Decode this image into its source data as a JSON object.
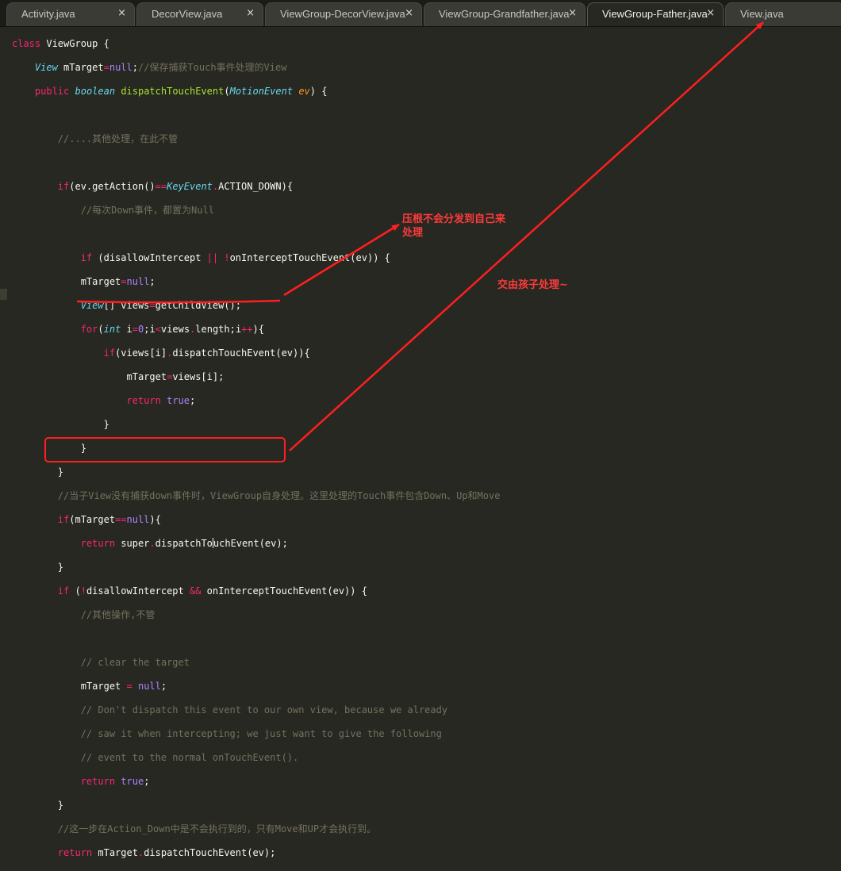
{
  "tabs": [
    {
      "label": "Activity.java",
      "active": false
    },
    {
      "label": "DecorView.java",
      "active": false
    },
    {
      "label": "ViewGroup-DecorView.java",
      "active": false
    },
    {
      "label": "ViewGroup-Grandfather.java",
      "active": false
    },
    {
      "label": "ViewGroup-Father.java",
      "active": true
    },
    {
      "label": "View.java",
      "active": false
    }
  ],
  "close_glyph": "×",
  "code": {
    "l1": {
      "a": "class",
      "b": " ViewGroup {"
    },
    "l2": {
      "a": "View",
      "b": " mTarget",
      "c": "=",
      "d": "null",
      "e": ";",
      "f": "//保存捕获Touch事件处理的View"
    },
    "l3": {
      "a": "public",
      "b": "boolean",
      "c": "dispatchTouchEvent",
      "d": "(",
      "e": "MotionEvent",
      "f": "ev",
      "g": ") {"
    },
    "l5": {
      "a": "//....其他处理，在此不管"
    },
    "l7": {
      "a": "if",
      "b": "(ev.",
      "c": "getAction",
      "d": "()",
      "e": "==",
      "f": "KeyEvent",
      "g": ".",
      "h": "ACTION_DOWN",
      "i": "){"
    },
    "l8": {
      "a": "//每次Down事件，都置为Null"
    },
    "l10": {
      "a": "if",
      "b": " (disallowIntercept ",
      "c": "||",
      "d": " ",
      "e": "!",
      "f": "onInterceptTouchEvent(ev)) {"
    },
    "l11": {
      "a": "mTarget",
      "b": "=",
      "c": "null",
      "d": ";"
    },
    "l12": {
      "a": "View",
      "b": "[] views",
      "c": "=",
      "d": "getChildView();"
    },
    "l13": {
      "a": "for",
      "b": "(",
      "c": "int",
      "d": " i",
      "e": "=",
      "f": "0",
      "g": ";i",
      "h": "<",
      "i": "views",
      "j": ".",
      "k": "length;i",
      "l": "++",
      "m": "){"
    },
    "l14": {
      "a": "if",
      "b": "(views[i]",
      "c": ".",
      "d": "dispatchTouchEvent(ev)){"
    },
    "l15": {
      "a": "mTarget",
      "b": "=",
      "c": "views[i];"
    },
    "l16": {
      "a": "return",
      "b": " ",
      "c": "true",
      "d": ";"
    },
    "l17": {
      "a": "}"
    },
    "l18": {
      "a": "}"
    },
    "l19": {
      "a": "}"
    },
    "l20": {
      "a": "//当子View没有捕获down事件时，ViewGroup自身处理。这里处理的Touch事件包含Down、Up和Move"
    },
    "l21": {
      "a": "if",
      "b": "(mTarget",
      "c": "==",
      "d": "null",
      "e": "){"
    },
    "l22": {
      "a": "return",
      "b": " super",
      "c": ".",
      "d": "dispatchTo",
      "e": "uchEvent(ev);"
    },
    "l23": {
      "a": "}"
    },
    "l24": {
      "a": "if",
      "b": " (",
      "c": "!",
      "d": "disallowIntercept ",
      "e": "&&",
      "f": " onInterceptTouchEvent(ev)) {"
    },
    "l25": {
      "a": "//其他操作,不管"
    },
    "l27": {
      "a": "// clear the target"
    },
    "l28": {
      "a": "mTarget ",
      "b": "=",
      "c": " ",
      "d": "null",
      "e": ";"
    },
    "l29": {
      "a": "// Don't dispatch this event to our own view, because we already"
    },
    "l30": {
      "a": "// saw it when intercepting; we just want to give the following"
    },
    "l31": {
      "a": "// event to the normal onTouchEvent()."
    },
    "l32": {
      "a": "return",
      "b": " ",
      "c": "true",
      "d": ";"
    },
    "l33": {
      "a": "}"
    },
    "l34": {
      "a": "//这一步在Action_Down中是不会执行到的，只有Move和UP才会执行到。"
    },
    "l35": {
      "a": "return",
      "b": " mTarget",
      "c": ".",
      "d": "dispatchTouchEvent(ev);"
    }
  },
  "annotations": {
    "note1_line1": "压根不会分发到自己来",
    "note1_line2": "处理",
    "note2": "交由孩子处理~",
    "color": "#ff1f1f"
  },
  "theme": {
    "background": "#272822",
    "keyword": "#f92672",
    "type": "#66d9ef",
    "function": "#a6e22e",
    "comment": "#75715e"
  }
}
